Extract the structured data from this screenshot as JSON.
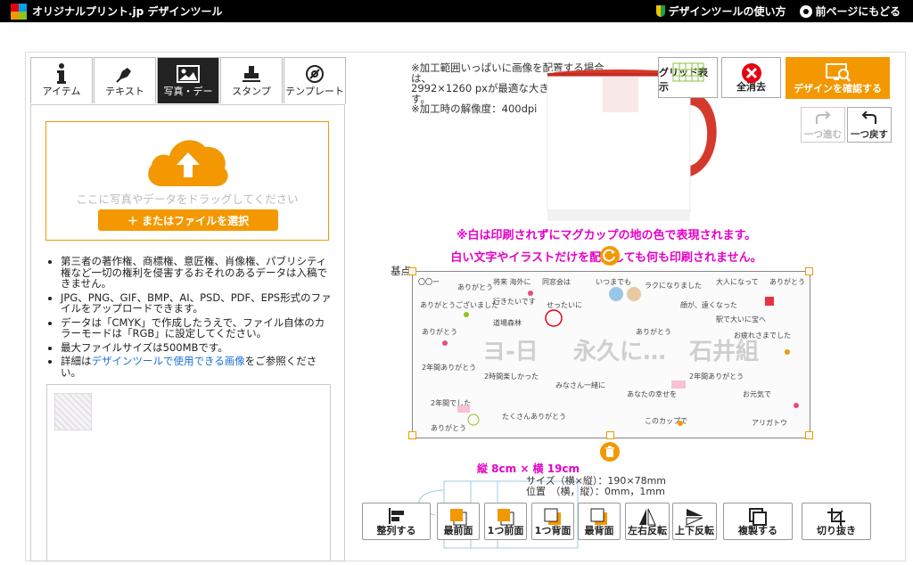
{
  "header": {
    "brand": "オリジナルプリント.jp デザインツール",
    "help_link": "デザインツールの使い方",
    "back_link": "前ページにもどる"
  },
  "tabs": [
    {
      "label": "アイテム",
      "icon": "info-icon"
    },
    {
      "label": "テキスト",
      "icon": "pen-icon"
    },
    {
      "label": "写真・デー",
      "icon": "image-icon",
      "active": true
    },
    {
      "label": "スタンプ",
      "icon": "stamp-icon"
    },
    {
      "label": "テンプレート",
      "icon": "template-icon"
    }
  ],
  "upload": {
    "drop_text": "ここに写真やデータをドラッグしてください",
    "file_button": "＋ またはファイルを選択"
  },
  "notes": [
    "第三者の著作権、商標権、意匠権、肖像権、パブリシティ権など一切の権利を侵害するおそれのあるデータは入稿できません。",
    "JPG、PNG、GIF、BMP、AI、PSD、PDF、EPS形式のファイルをアップロードできます。",
    "データは「CMYK」で作成したうえで、ファイル自体のカラーモードは「RGB」に設定してください。",
    "最大ファイルサイズは500MBです。"
  ],
  "note_link": {
    "prefix": "詳細は",
    "link": "デザインツールで使用できる画像",
    "suffix": "をご参照ください。"
  },
  "print_info": {
    "line1": "※加工範囲いっぱいに画像を配置する場合は、",
    "line2": "2992×1260 pxが最適な大きさになります。",
    "line3": "※加工時の解像度：400dpi"
  },
  "toolbar": {
    "grid_label": "グリッド表示",
    "clear_label": "全消去",
    "confirm_label": "デザインを確認する",
    "redo_label": "一つ進む",
    "undo_label": "一つ戻す"
  },
  "warnings": {
    "line1": "※白は印刷されずにマグカップの地の色で表現されます。",
    "line2": "白い文字やイラストだけを配置しても何も印刷されません。"
  },
  "canvas": {
    "base_label": "基点",
    "dims_label": "縦 8cm × 横 19cm",
    "size_line": "サイズ（横×縦）：190×78mm",
    "pos_line": "位置　（横，縦）：0mm，1mm",
    "art_text_1": "ヨ-日",
    "art_text_2": "永久に…",
    "art_text_3": "石井組"
  },
  "bottom_buttons": [
    {
      "label": "整列する",
      "icon": "align-icon"
    },
    {
      "label": "最前面",
      "icon": "bring-front-icon"
    },
    {
      "label": "1つ前面",
      "icon": "bring-forward-icon"
    },
    {
      "label": "1つ背面",
      "icon": "send-backward-icon"
    },
    {
      "label": "最背面",
      "icon": "send-back-icon"
    },
    {
      "label": "左右反転",
      "icon": "flip-h-icon"
    },
    {
      "label": "上下反転",
      "icon": "flip-v-icon"
    },
    {
      "label": "複製する",
      "icon": "duplicate-icon"
    },
    {
      "label": "切り抜き",
      "icon": "crop-icon"
    }
  ],
  "colors": {
    "accent": "#f39800",
    "warning": "#e600c8",
    "header_bg": "#000000"
  }
}
